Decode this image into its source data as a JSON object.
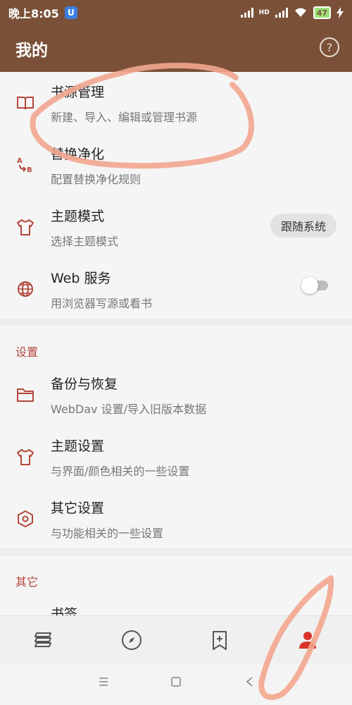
{
  "status_bar": {
    "time": "晚上8:05",
    "app_badge": "U",
    "network_label": "HD",
    "battery": "47"
  },
  "appbar": {
    "title": "我的",
    "help_icon": "question-circle-icon"
  },
  "items": [
    {
      "title": "书源管理",
      "subtitle": "新建、导入、编辑或管理书源",
      "icon": "book-open-icon"
    },
    {
      "title": "替换净化",
      "subtitle": "配置替换净化规则",
      "icon": "replace-ab-icon"
    },
    {
      "title": "主题模式",
      "subtitle": "选择主题模式",
      "icon": "tshirt-icon",
      "value": "跟随系统"
    },
    {
      "title": "Web 服务",
      "subtitle": "用浏览器写源或看书",
      "icon": "globe-icon",
      "toggle": false
    }
  ],
  "settings": {
    "header": "设置",
    "items": [
      {
        "title": "备份与恢复",
        "subtitle": "WebDav 设置/导入旧版本数据",
        "icon": "folder-icon"
      },
      {
        "title": "主题设置",
        "subtitle": "与界面/颜色相关的一些设置",
        "icon": "tshirt-icon"
      },
      {
        "title": "其它设置",
        "subtitle": "与功能相关的一些设置",
        "icon": "hexagon-settings-icon"
      }
    ]
  },
  "other": {
    "header": "其它",
    "items": [
      {
        "title": "书签"
      }
    ]
  },
  "bottom_nav": [
    "bookshelf-icon",
    "compass-icon",
    "bookmark-add-icon",
    "person-icon"
  ],
  "colors": {
    "primary": "#7a5138",
    "accent": "#b4473b",
    "active_nav": "#d8342c"
  }
}
